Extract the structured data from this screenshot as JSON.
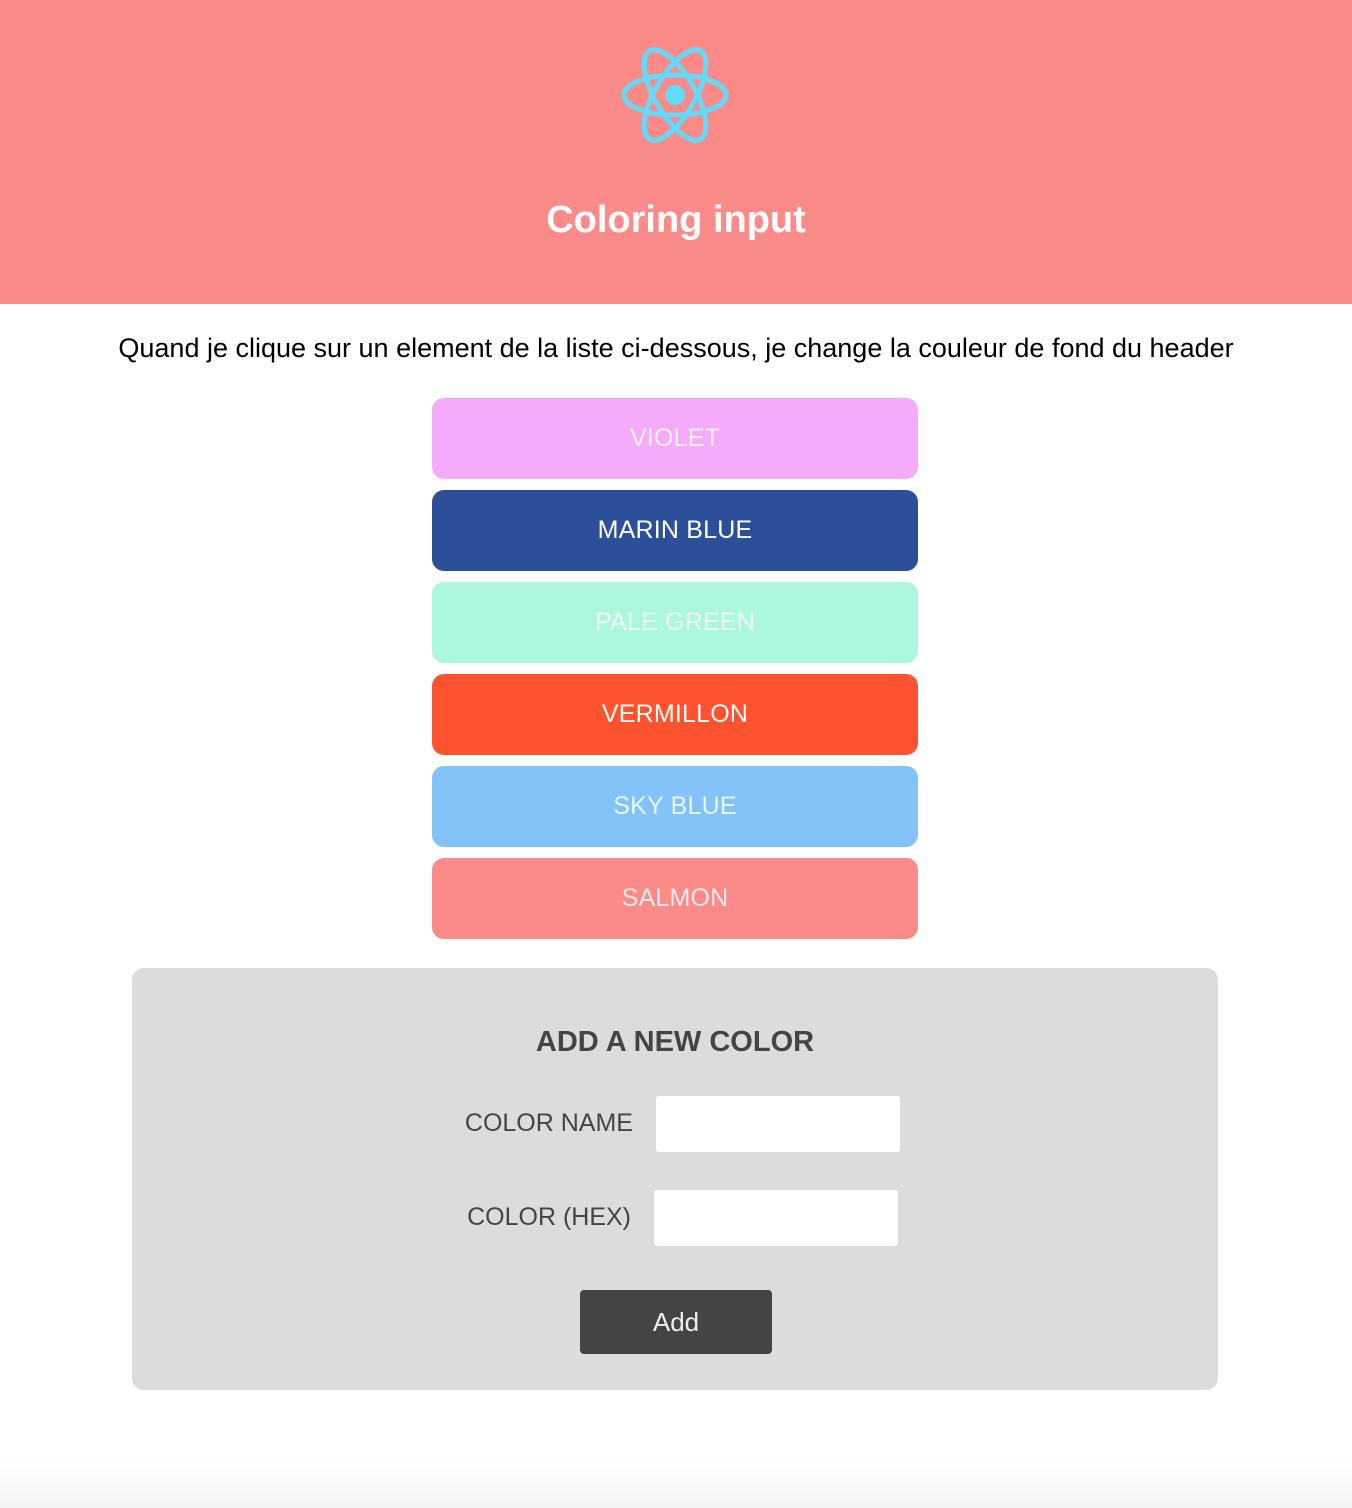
{
  "header": {
    "logo_icon": "react-atom-icon",
    "title": "Coloring input",
    "background_color": "#fb8b88"
  },
  "intro_text": "Quand je clique sur un element de la liste ci-dessous, je change la couleur de fond du header",
  "colors": [
    {
      "label": "VIOLET",
      "hex": "#f4abfa"
    },
    {
      "label": "MARIN BLUE",
      "hex": "#2c4f99"
    },
    {
      "label": "PALE GREEN",
      "hex": "#abf8dd"
    },
    {
      "label": "VERMILLON",
      "hex": "#ff522f"
    },
    {
      "label": "SKY BLUE",
      "hex": "#84c3f8"
    },
    {
      "label": "SALMON",
      "hex": "#fb8b88"
    }
  ],
  "form": {
    "title": "ADD A NEW COLOR",
    "name_label": "COLOR NAME",
    "name_value": "",
    "hex_label": "COLOR (HEX)",
    "hex_value": "",
    "submit_label": "Add"
  }
}
